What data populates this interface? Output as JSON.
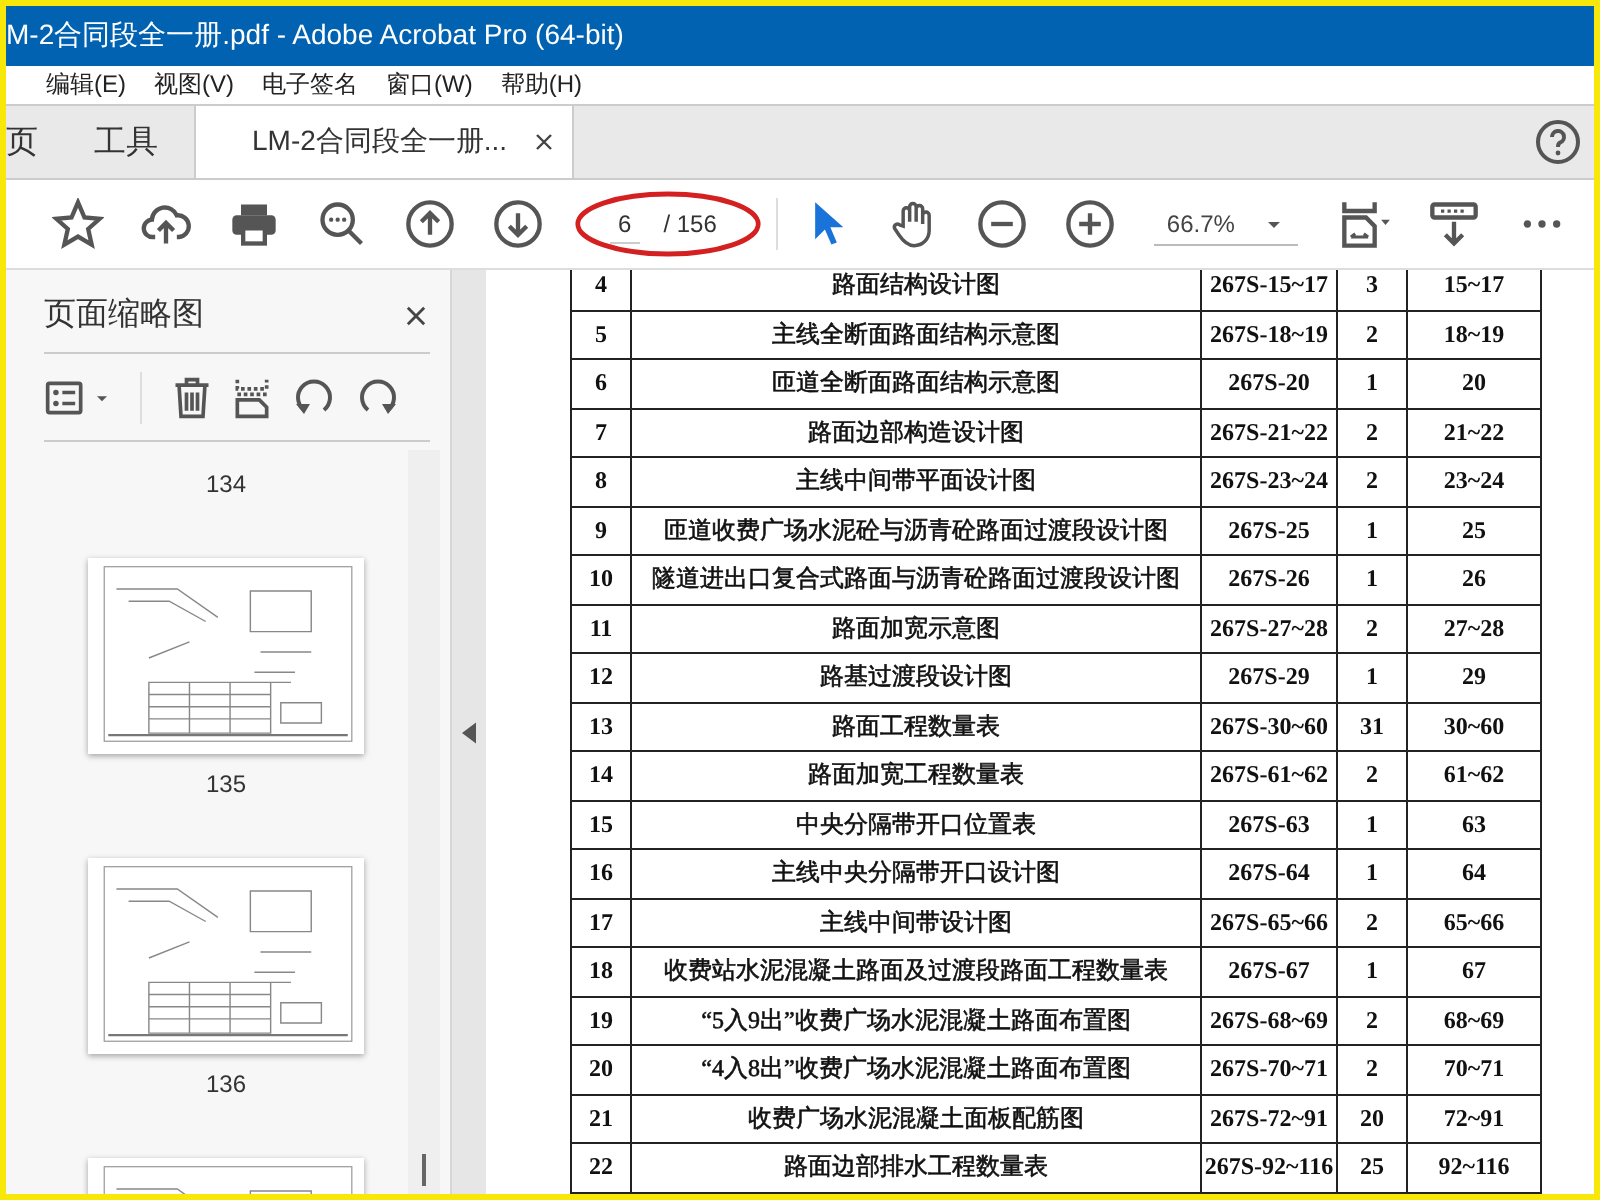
{
  "window": {
    "title": "M-2合同段全一册.pdf - Adobe Acrobat Pro (64-bit)"
  },
  "menu": [
    "编辑(E)",
    "视图(V)",
    "电子签名",
    "窗口(W)",
    "帮助(H)"
  ],
  "tabs": [
    {
      "label": "页",
      "selected": false,
      "closable": false
    },
    {
      "label": "工具",
      "selected": false,
      "closable": false
    },
    {
      "label": "LM-2合同段全一册...",
      "selected": true,
      "closable": true
    }
  ],
  "toolbar": {
    "page_current": "6",
    "page_total": "/ 156",
    "zoom": "66.7%",
    "tools": [
      {
        "kind": "pointer",
        "selected": true
      },
      {
        "kind": "hand",
        "selected": false
      }
    ]
  },
  "sidebar": {
    "title": "页面缩略图",
    "thumbnails": [
      {
        "kind": "label",
        "label": "134"
      },
      {
        "kind": "page",
        "label": "135"
      },
      {
        "kind": "page",
        "label": "136"
      },
      {
        "kind": "page"
      }
    ]
  },
  "table": {
    "rows": [
      {
        "cells": [
          "4",
          "路面结构设计图",
          "267S-15~17",
          "3",
          "15~17"
        ]
      },
      {
        "cells": [
          "5",
          "主线全断面路面结构示意图",
          "267S-18~19",
          "2",
          "18~19"
        ]
      },
      {
        "cells": [
          "6",
          "匝道全断面路面结构示意图",
          "267S-20",
          "1",
          "20"
        ]
      },
      {
        "cells": [
          "7",
          "路面边部构造设计图",
          "267S-21~22",
          "2",
          "21~22"
        ]
      },
      {
        "cells": [
          "8",
          "主线中间带平面设计图",
          "267S-23~24",
          "2",
          "23~24"
        ]
      },
      {
        "cells": [
          "9",
          "匝道收费广场水泥砼与沥青砼路面过渡段设计图",
          "267S-25",
          "1",
          "25"
        ]
      },
      {
        "cells": [
          "10",
          "隧道进出口复合式路面与沥青砼路面过渡段设计图",
          "267S-26",
          "1",
          "26"
        ]
      },
      {
        "cells": [
          "11",
          "路面加宽示意图",
          "267S-27~28",
          "2",
          "27~28"
        ]
      },
      {
        "cells": [
          "12",
          "路基过渡段设计图",
          "267S-29",
          "1",
          "29"
        ]
      },
      {
        "cells": [
          "13",
          "路面工程数量表",
          "267S-30~60",
          "31",
          "30~60"
        ]
      },
      {
        "cells": [
          "14",
          "路面加宽工程数量表",
          "267S-61~62",
          "2",
          "61~62"
        ]
      },
      {
        "cells": [
          "15",
          "中央分隔带开口位置表",
          "267S-63",
          "1",
          "63"
        ]
      },
      {
        "cells": [
          "16",
          "主线中央分隔带开口设计图",
          "267S-64",
          "1",
          "64"
        ]
      },
      {
        "cells": [
          "17",
          "主线中间带设计图",
          "267S-65~66",
          "2",
          "65~66"
        ]
      },
      {
        "cells": [
          "18",
          "收费站水泥混凝土路面及过渡段路面工程数量表",
          "267S-67",
          "1",
          "67"
        ]
      },
      {
        "cells": [
          "19",
          "“5入9出”收费广场水泥混凝土路面布置图",
          "267S-68~69",
          "2",
          "68~69"
        ]
      },
      {
        "cells": [
          "20",
          "“4入8出”收费广场水泥混凝土路面布置图",
          "267S-70~71",
          "2",
          "70~71"
        ]
      },
      {
        "cells": [
          "21",
          "收费广场水泥混凝土面板配筋图",
          "267S-72~91",
          "20",
          "72~91"
        ]
      },
      {
        "cells": [
          "22",
          "路面边部排水工程数量表",
          "267S-92~116",
          "25",
          "92~116"
        ]
      }
    ]
  }
}
